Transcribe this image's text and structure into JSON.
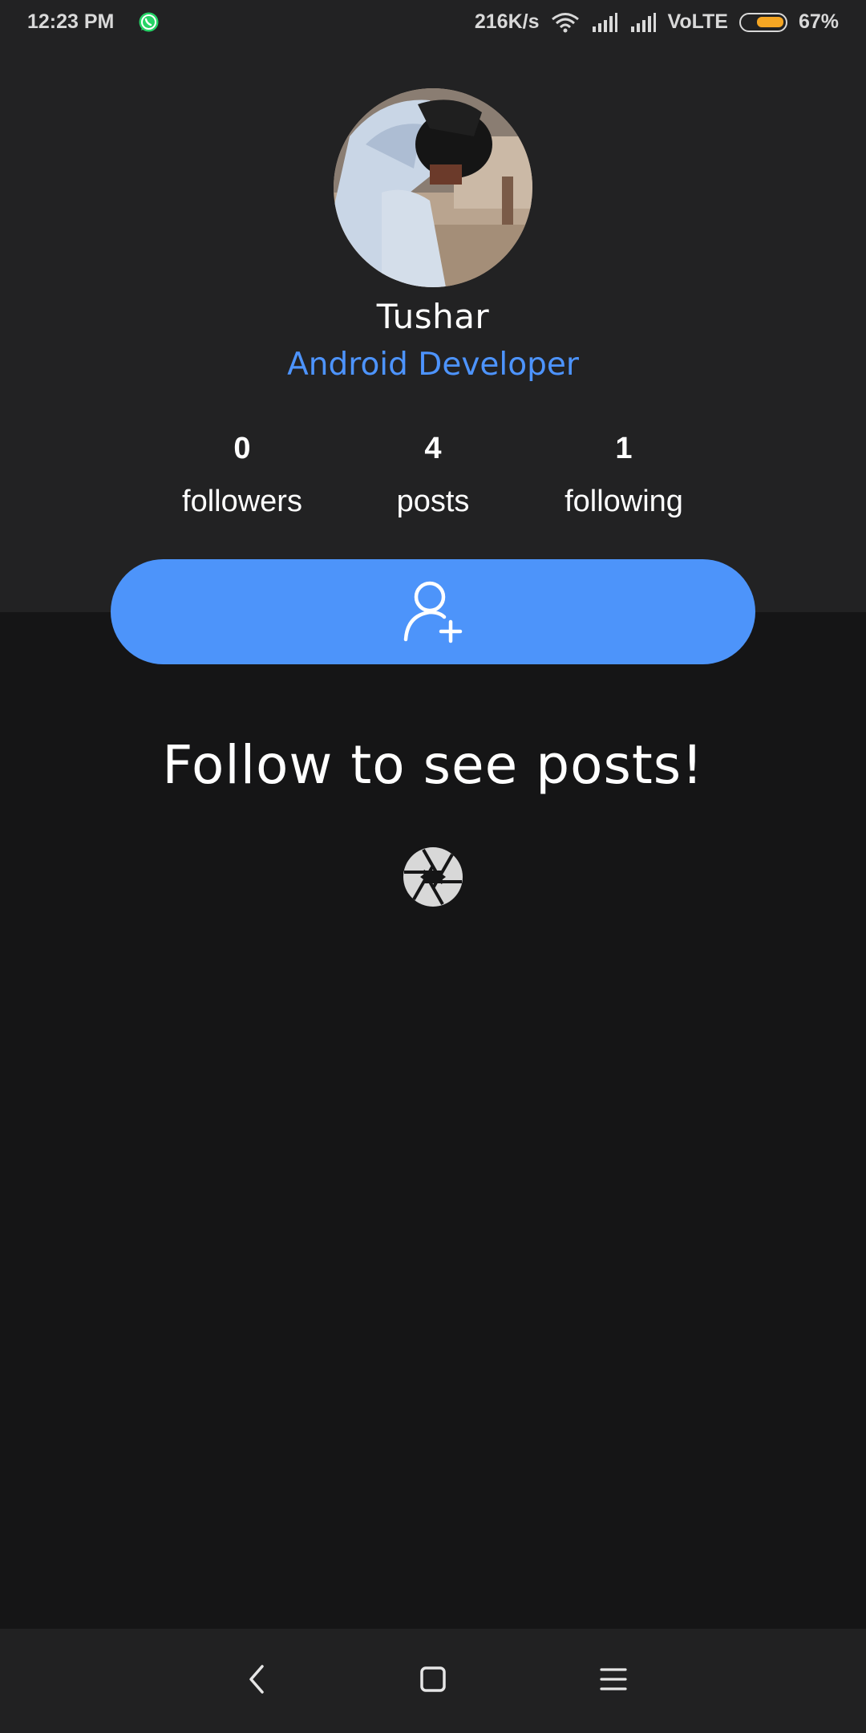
{
  "status_bar": {
    "time": "12:23 PM",
    "net_speed": "216K/s",
    "network_type": "VoLTE",
    "battery_percent": "67%",
    "battery_level": 0.67,
    "icons": [
      "whatsapp-icon",
      "wifi-icon",
      "signal-icon",
      "signal-icon",
      "battery-icon"
    ]
  },
  "profile": {
    "name": "Tushar",
    "role": "Android Developer",
    "stats": {
      "followers": {
        "count": "0",
        "label": "followers"
      },
      "posts": {
        "count": "4",
        "label": "posts"
      },
      "following": {
        "count": "1",
        "label": "following"
      }
    },
    "follow_button_icon": "add-user-icon"
  },
  "feed": {
    "empty_message": "Follow to see posts!",
    "empty_icon": "aperture-icon"
  },
  "nav_bar": {
    "icons": [
      "back-icon",
      "home-icon",
      "recents-icon"
    ]
  },
  "colors": {
    "accent": "#4d94fa",
    "top_panel": "#222223",
    "background": "#151516",
    "battery_fill": "#f5a623",
    "whatsapp": "#25d366"
  }
}
